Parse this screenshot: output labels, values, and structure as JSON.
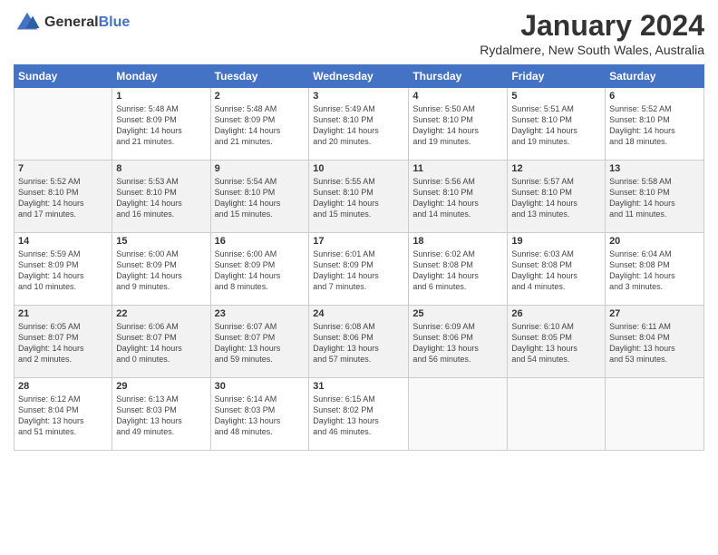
{
  "header": {
    "logo_general": "General",
    "logo_blue": "Blue",
    "title": "January 2024",
    "location": "Rydalmere, New South Wales, Australia"
  },
  "calendar": {
    "weekdays": [
      "Sunday",
      "Monday",
      "Tuesday",
      "Wednesday",
      "Thursday",
      "Friday",
      "Saturday"
    ],
    "weeks": [
      [
        {
          "num": "",
          "info": ""
        },
        {
          "num": "1",
          "info": "Sunrise: 5:48 AM\nSunset: 8:09 PM\nDaylight: 14 hours\nand 21 minutes."
        },
        {
          "num": "2",
          "info": "Sunrise: 5:48 AM\nSunset: 8:09 PM\nDaylight: 14 hours\nand 21 minutes."
        },
        {
          "num": "3",
          "info": "Sunrise: 5:49 AM\nSunset: 8:10 PM\nDaylight: 14 hours\nand 20 minutes."
        },
        {
          "num": "4",
          "info": "Sunrise: 5:50 AM\nSunset: 8:10 PM\nDaylight: 14 hours\nand 19 minutes."
        },
        {
          "num": "5",
          "info": "Sunrise: 5:51 AM\nSunset: 8:10 PM\nDaylight: 14 hours\nand 19 minutes."
        },
        {
          "num": "6",
          "info": "Sunrise: 5:52 AM\nSunset: 8:10 PM\nDaylight: 14 hours\nand 18 minutes."
        }
      ],
      [
        {
          "num": "7",
          "info": "Sunrise: 5:52 AM\nSunset: 8:10 PM\nDaylight: 14 hours\nand 17 minutes."
        },
        {
          "num": "8",
          "info": "Sunrise: 5:53 AM\nSunset: 8:10 PM\nDaylight: 14 hours\nand 16 minutes."
        },
        {
          "num": "9",
          "info": "Sunrise: 5:54 AM\nSunset: 8:10 PM\nDaylight: 14 hours\nand 15 minutes."
        },
        {
          "num": "10",
          "info": "Sunrise: 5:55 AM\nSunset: 8:10 PM\nDaylight: 14 hours\nand 15 minutes."
        },
        {
          "num": "11",
          "info": "Sunrise: 5:56 AM\nSunset: 8:10 PM\nDaylight: 14 hours\nand 14 minutes."
        },
        {
          "num": "12",
          "info": "Sunrise: 5:57 AM\nSunset: 8:10 PM\nDaylight: 14 hours\nand 13 minutes."
        },
        {
          "num": "13",
          "info": "Sunrise: 5:58 AM\nSunset: 8:10 PM\nDaylight: 14 hours\nand 11 minutes."
        }
      ],
      [
        {
          "num": "14",
          "info": "Sunrise: 5:59 AM\nSunset: 8:09 PM\nDaylight: 14 hours\nand 10 minutes."
        },
        {
          "num": "15",
          "info": "Sunrise: 6:00 AM\nSunset: 8:09 PM\nDaylight: 14 hours\nand 9 minutes."
        },
        {
          "num": "16",
          "info": "Sunrise: 6:00 AM\nSunset: 8:09 PM\nDaylight: 14 hours\nand 8 minutes."
        },
        {
          "num": "17",
          "info": "Sunrise: 6:01 AM\nSunset: 8:09 PM\nDaylight: 14 hours\nand 7 minutes."
        },
        {
          "num": "18",
          "info": "Sunrise: 6:02 AM\nSunset: 8:08 PM\nDaylight: 14 hours\nand 6 minutes."
        },
        {
          "num": "19",
          "info": "Sunrise: 6:03 AM\nSunset: 8:08 PM\nDaylight: 14 hours\nand 4 minutes."
        },
        {
          "num": "20",
          "info": "Sunrise: 6:04 AM\nSunset: 8:08 PM\nDaylight: 14 hours\nand 3 minutes."
        }
      ],
      [
        {
          "num": "21",
          "info": "Sunrise: 6:05 AM\nSunset: 8:07 PM\nDaylight: 14 hours\nand 2 minutes."
        },
        {
          "num": "22",
          "info": "Sunrise: 6:06 AM\nSunset: 8:07 PM\nDaylight: 14 hours\nand 0 minutes."
        },
        {
          "num": "23",
          "info": "Sunrise: 6:07 AM\nSunset: 8:07 PM\nDaylight: 13 hours\nand 59 minutes."
        },
        {
          "num": "24",
          "info": "Sunrise: 6:08 AM\nSunset: 8:06 PM\nDaylight: 13 hours\nand 57 minutes."
        },
        {
          "num": "25",
          "info": "Sunrise: 6:09 AM\nSunset: 8:06 PM\nDaylight: 13 hours\nand 56 minutes."
        },
        {
          "num": "26",
          "info": "Sunrise: 6:10 AM\nSunset: 8:05 PM\nDaylight: 13 hours\nand 54 minutes."
        },
        {
          "num": "27",
          "info": "Sunrise: 6:11 AM\nSunset: 8:04 PM\nDaylight: 13 hours\nand 53 minutes."
        }
      ],
      [
        {
          "num": "28",
          "info": "Sunrise: 6:12 AM\nSunset: 8:04 PM\nDaylight: 13 hours\nand 51 minutes."
        },
        {
          "num": "29",
          "info": "Sunrise: 6:13 AM\nSunset: 8:03 PM\nDaylight: 13 hours\nand 49 minutes."
        },
        {
          "num": "30",
          "info": "Sunrise: 6:14 AM\nSunset: 8:03 PM\nDaylight: 13 hours\nand 48 minutes."
        },
        {
          "num": "31",
          "info": "Sunrise: 6:15 AM\nSunset: 8:02 PM\nDaylight: 13 hours\nand 46 minutes."
        },
        {
          "num": "",
          "info": ""
        },
        {
          "num": "",
          "info": ""
        },
        {
          "num": "",
          "info": ""
        }
      ]
    ]
  }
}
